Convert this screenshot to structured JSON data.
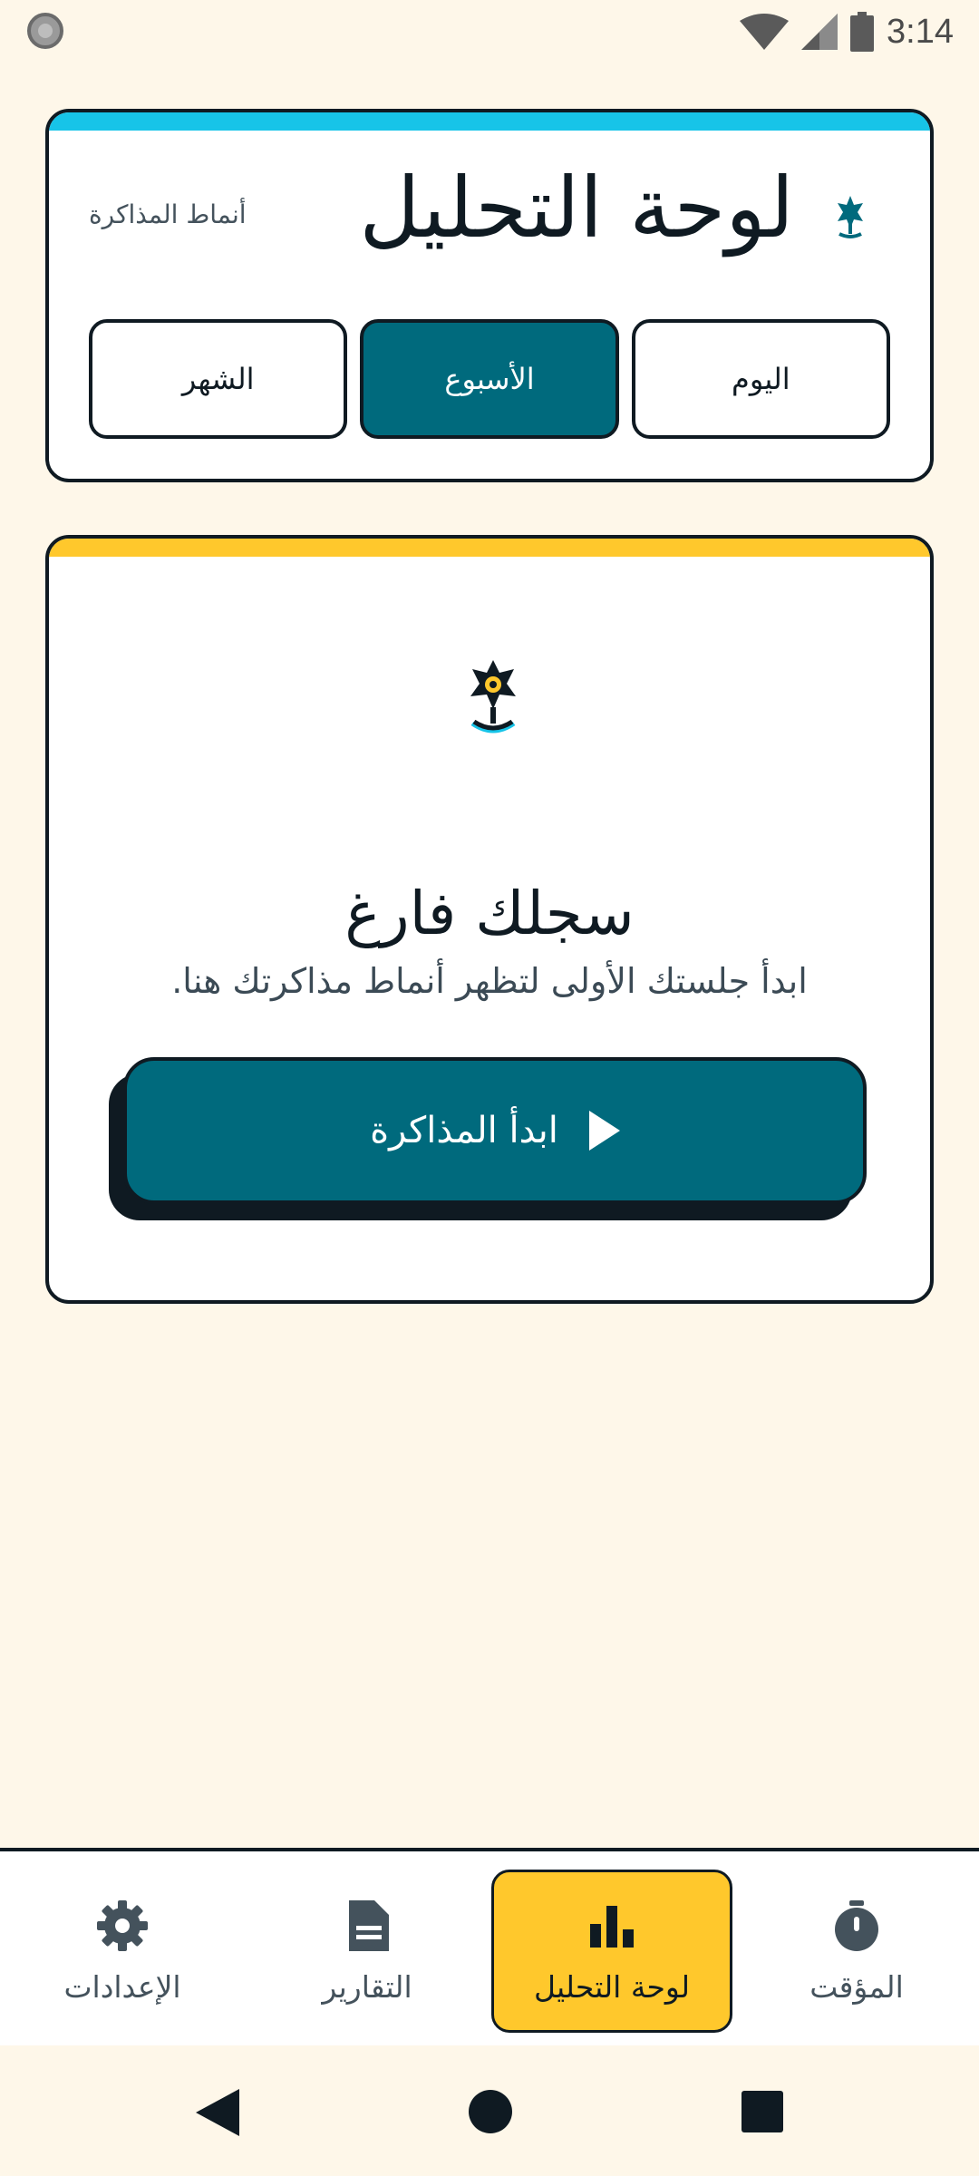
{
  "status_bar": {
    "time": "3:14"
  },
  "header": {
    "title": "لوحة التحليل",
    "subtitle": "أنماط المذاكرة",
    "periods": [
      {
        "label": "اليوم",
        "active": false
      },
      {
        "label": "الأسبوع",
        "active": true
      },
      {
        "label": "الشهر",
        "active": false
      }
    ]
  },
  "empty_state": {
    "title": "سجلك فارغ",
    "description": "ابدأ جلستك الأولى لتظهر أنماط مذاكرتك هنا.",
    "start_button": "ابدأ المذاكرة"
  },
  "bottom_nav": {
    "items": [
      {
        "label": "المؤقت",
        "icon": "timer-icon",
        "active": false
      },
      {
        "label": "لوحة التحليل",
        "icon": "bar-chart-icon",
        "active": true
      },
      {
        "label": "التقارير",
        "icon": "document-icon",
        "active": false
      },
      {
        "label": "الإعدادات",
        "icon": "gear-icon",
        "active": false
      }
    ]
  },
  "colors": {
    "background": "#fef7e9",
    "teal": "#006a7d",
    "cyan_stripe": "#17c4e8",
    "yellow": "#ffc82c",
    "ink": "#0f1a22"
  }
}
